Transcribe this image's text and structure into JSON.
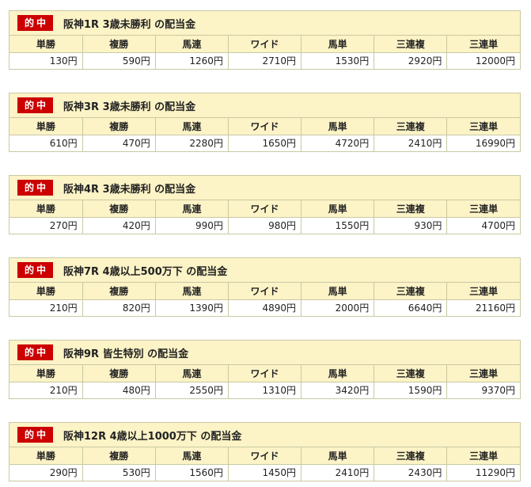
{
  "badge_label": "的中",
  "columns": [
    "単勝",
    "複勝",
    "馬連",
    "ワイド",
    "馬単",
    "三連複",
    "三連単"
  ],
  "races": [
    {
      "title": "阪神1R 3歳未勝利 の配当金",
      "payouts": [
        "130円",
        "590円",
        "1260円",
        "2710円",
        "1530円",
        "2920円",
        "12000円"
      ]
    },
    {
      "title": "阪神3R 3歳未勝利 の配当金",
      "payouts": [
        "610円",
        "470円",
        "2280円",
        "1650円",
        "4720円",
        "2410円",
        "16990円"
      ]
    },
    {
      "title": "阪神4R 3歳未勝利 の配当金",
      "payouts": [
        "270円",
        "420円",
        "990円",
        "980円",
        "1550円",
        "930円",
        "4700円"
      ]
    },
    {
      "title": "阪神7R 4歳以上500万下 の配当金",
      "payouts": [
        "210円",
        "820円",
        "1390円",
        "4890円",
        "2000円",
        "6640円",
        "21160円"
      ]
    },
    {
      "title": "阪神9R 皆生特別 の配当金",
      "payouts": [
        "210円",
        "480円",
        "2550円",
        "1310円",
        "3420円",
        "1590円",
        "9370円"
      ]
    },
    {
      "title": "阪神12R 4歳以上1000万下 の配当金",
      "payouts": [
        "290円",
        "530円",
        "1560円",
        "1450円",
        "2410円",
        "2430円",
        "11290円"
      ]
    }
  ]
}
